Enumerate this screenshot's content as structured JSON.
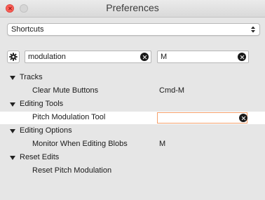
{
  "window": {
    "title": "Preferences"
  },
  "category_select": {
    "value": "Shortcuts"
  },
  "search": {
    "filter_value": "modulation",
    "key_value": "M"
  },
  "groups": [
    {
      "label": "Tracks",
      "commands": [
        {
          "name": "Clear Mute Buttons",
          "shortcut": "Cmd-M"
        }
      ]
    },
    {
      "label": "Editing Tools",
      "commands": [
        {
          "name": "Pitch Modulation Tool",
          "shortcut": "",
          "selected": true
        }
      ]
    },
    {
      "label": "Editing Options",
      "commands": [
        {
          "name": "Monitor When Editing Blobs",
          "shortcut": "M"
        }
      ]
    },
    {
      "label": "Reset Edits",
      "commands": [
        {
          "name": "Reset Pitch Modulation",
          "shortcut": ""
        }
      ]
    }
  ],
  "colors": {
    "selection_border": "#f5a06b",
    "close_button": "#fc5f57"
  }
}
